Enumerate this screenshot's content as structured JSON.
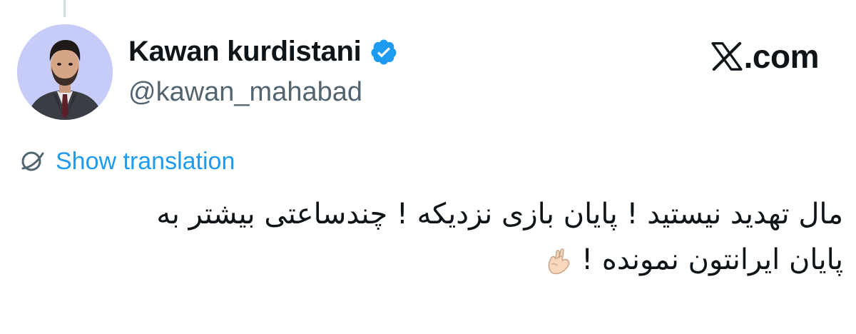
{
  "author": {
    "display_name": "Kawan kurdistani",
    "handle": "@kawan_mahabad",
    "verified_badge": "verified-icon",
    "avatar_bg": "#c7cbf7"
  },
  "brand": {
    "text": ".com",
    "logo": "x-logo-icon"
  },
  "translation": {
    "label": "Show translation",
    "icon": "globe-icon",
    "color": "#1d9bf0"
  },
  "tweet": {
    "lines": [
      "مال تهدید نیستید ! پایان بازی نزدیکه ! چندساعتی بیشتر به",
      "پایان ایرانتون نمونده !"
    ],
    "emoji": "crossed-fingers-icon"
  },
  "colors": {
    "text": "#0f1419",
    "secondary": "#536471",
    "accent": "#1d9bf0",
    "thread_line": "#cfd9de"
  }
}
